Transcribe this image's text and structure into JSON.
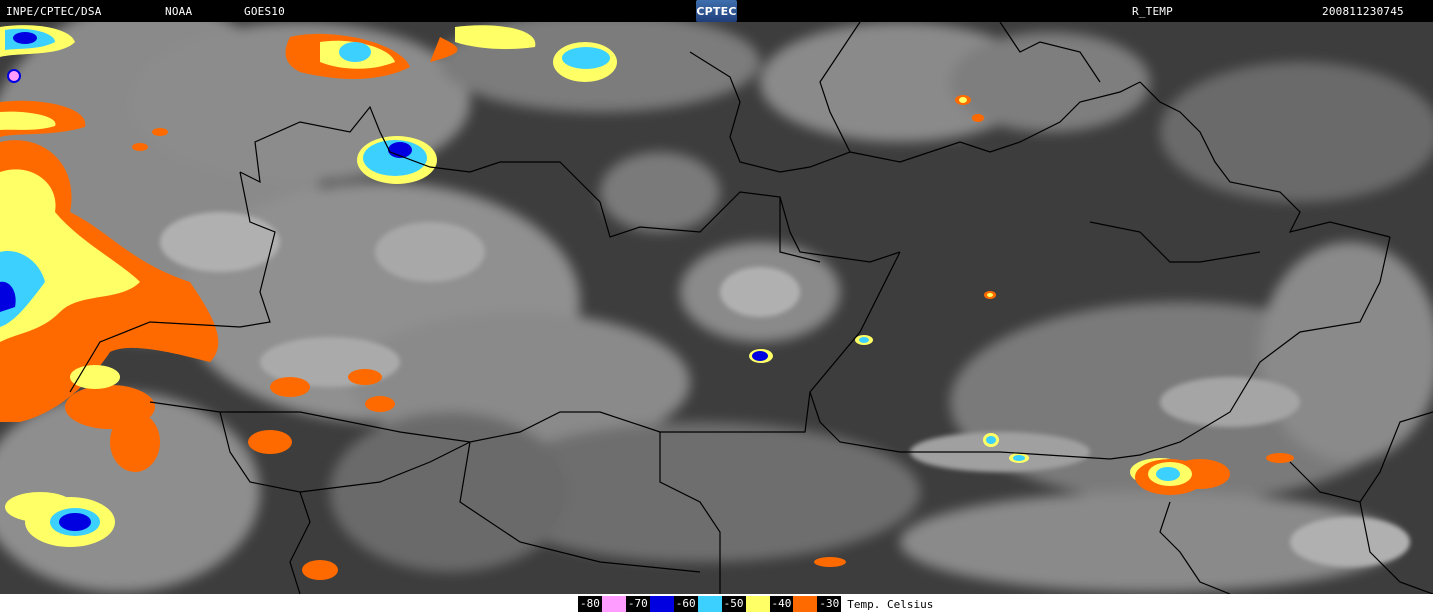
{
  "header": {
    "institution": "INPE/CPTEC/DSA",
    "agency": "NOAA",
    "satellite": "GOES10",
    "logo_text": "CPTEC",
    "product": "R_TEMP",
    "timestamp": "200811230745"
  },
  "legend": {
    "label": "Temp. Celsius",
    "items": [
      {
        "value": "-80",
        "color": "#ff9cff"
      },
      {
        "value": "-70",
        "color": "#0000e0"
      },
      {
        "value": "-60",
        "color": "#3cd0ff"
      },
      {
        "value": "-50",
        "color": "#ffff66"
      },
      {
        "value": "-40",
        "color": "#ff6a00"
      },
      {
        "value": "-30",
        "color": "#000000"
      }
    ]
  },
  "colors": {
    "background_cloud_dark": "#3b3b3b",
    "background_cloud_light": "#a9a9a9",
    "border_lines": "#000000"
  }
}
